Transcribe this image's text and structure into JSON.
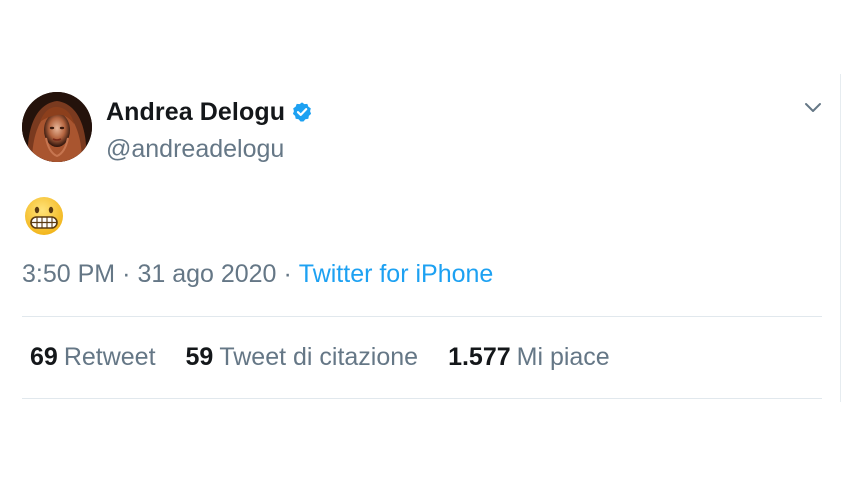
{
  "tweet": {
    "author": {
      "display_name": "Andrea Delogu",
      "handle": "@andreadelogu",
      "verified": true,
      "avatar_icon": "profile-photo"
    },
    "body": {
      "emoji": "grimacing-face"
    },
    "meta": {
      "time": "3:50 PM",
      "separator": "·",
      "date": "31 ago 2020",
      "source": "Twitter for iPhone"
    },
    "stats": [
      {
        "count": "69",
        "label": "Retweet"
      },
      {
        "count": "59",
        "label": "Tweet di citazione"
      },
      {
        "count": "1.577",
        "label": "Mi piace"
      }
    ],
    "menu_icon": "chevron-down-icon"
  },
  "colors": {
    "text_primary": "#14171a",
    "text_secondary": "#657786",
    "link": "#1da1f2",
    "verified_badge": "#1da1f2",
    "divider": "#e1e8ed"
  }
}
